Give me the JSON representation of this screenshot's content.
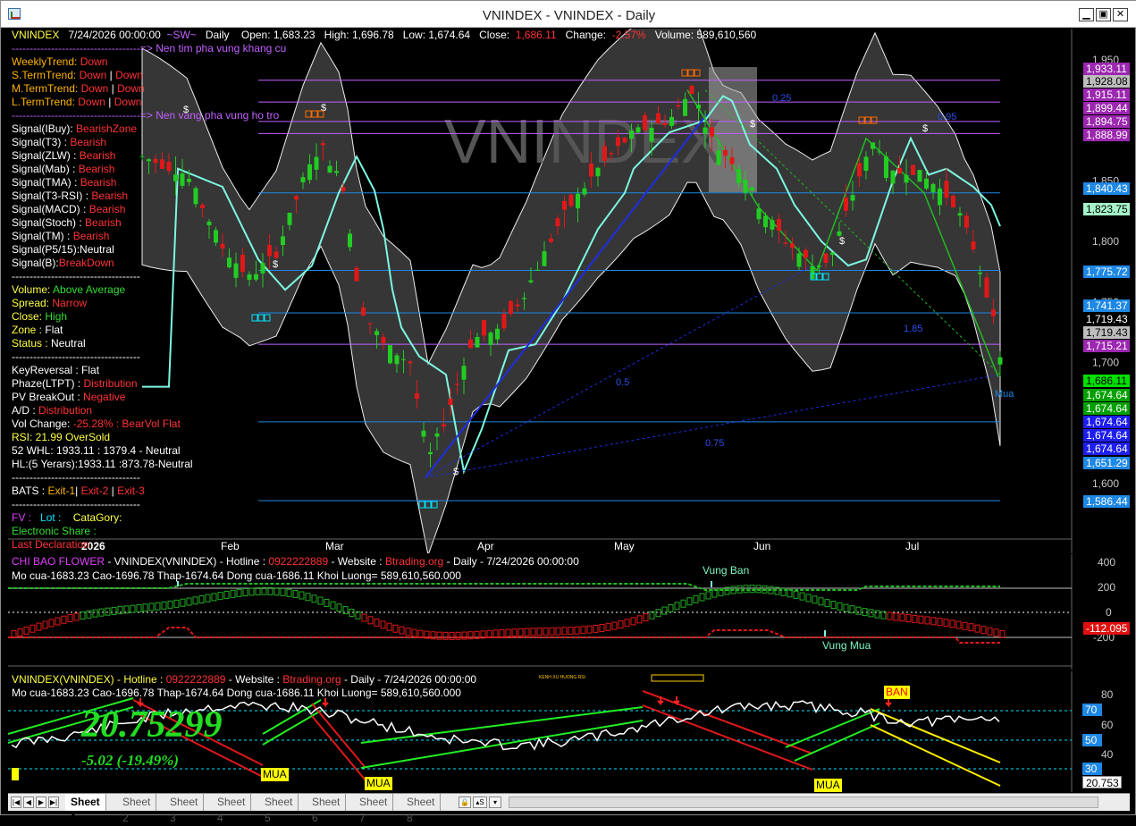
{
  "window": {
    "title": "VNINDEX - VNINDEX - Daily"
  },
  "watermark": "VNINDEX",
  "header": {
    "symbol": "VNINDEX",
    "date": "7/24/2026 00:00:00",
    "sw": "~SW~",
    "timeframe": "Daily",
    "open": "Open:  1,683.23",
    "high": "High:  1,696.78",
    "low": "Low:  1,674.64",
    "close_lbl": "Close:",
    "close_val": "1,686.11",
    "change_lbl": "Change:",
    "change_val": "-2.57%",
    "volume": "Volume:  589,610,560"
  },
  "notes": {
    "resistance": "------------------------------------=> Nen tim pha vung khang cu",
    "support": "------------------------------------=> Nen vang pha vung ho tro"
  },
  "trends": [
    {
      "label": "WeeklyTrend: ",
      "values": [
        "Down"
      ]
    },
    {
      "label": "S.TermTrend: ",
      "values": [
        "Down",
        "Down"
      ]
    },
    {
      "label": "M.TermTrend: ",
      "values": [
        "Down",
        "Down"
      ]
    },
    {
      "label": "L.TermTrend: ",
      "values": [
        "Down",
        "Down"
      ]
    }
  ],
  "signals": [
    {
      "label": "Signal(IBuy): ",
      "value": "BearishZone"
    },
    {
      "label": "Signal(T3)    :   ",
      "value": "Bearish"
    },
    {
      "label": "Signal(ZLW)  :   ",
      "value": "Bearish"
    },
    {
      "label": "Signal(Mab)  :   ",
      "value": "Bearish"
    },
    {
      "label": "Signal(TMA)  :   ",
      "value": "Bearish"
    },
    {
      "label": "Signal(T3-RSI) : ",
      "value": "Bearish"
    },
    {
      "label": "Signal(MACD) : ",
      "value": "Bearish"
    },
    {
      "label": "Signal(Stoch) : ",
      "value": "Bearish"
    },
    {
      "label": "Signal(TM) : ",
      "value": "Bearish"
    },
    {
      "label": "Signal(P5/15):",
      "value": "Neutral"
    },
    {
      "label": "Signal(B):",
      "value": "BreakDown"
    }
  ],
  "volume_block": [
    {
      "label": "Volume: ",
      "value": "Above Average",
      "color": "#33dd33"
    },
    {
      "label": "Spread:  ",
      "value": "Narrow",
      "color": "#ff3333"
    },
    {
      "label": "Close: ",
      "value": "High",
      "color": "#33dd33"
    },
    {
      "label": "Zone : ",
      "value": "Flat",
      "color": "#ffffff"
    },
    {
      "label": "Status : ",
      "value": "Neutral",
      "color": "#ffffff"
    }
  ],
  "stats": [
    {
      "label": "KeyReversal : ",
      "value": "Flat",
      "color": "#ffffff"
    },
    {
      "label": "Phaze(LTPT) : ",
      "value": "Distribution",
      "color": "#ff3333"
    },
    {
      "label": "PV BreakOut : ",
      "value": "Negative",
      "color": "#ff3333"
    },
    {
      "label": "A/D : ",
      "value": "Distribution",
      "color": "#ff3333"
    },
    {
      "label": "Vol Change: ",
      "value": "-25.28% : BearVol Flat",
      "color": "#ff3333"
    },
    {
      "label": "RSI: ",
      "value": "21.99  OverSold",
      "color": "#ffff44"
    },
    {
      "label": "52 WHL: 1933.11 : 1379.4 - Neutral",
      "value": "",
      "color": "#ffffff"
    },
    {
      "label": "HL:(5 Yerars):1933.11 :873.78-Neutral",
      "value": "",
      "color": "#ffffff"
    }
  ],
  "bats": {
    "label": "BATS : ",
    "exit1": "Exit-1",
    "exit2": "Exit-2",
    "exit3": "Exit-3"
  },
  "fv": {
    "fv": "FV :",
    "lot": "Lot :",
    "catagory": "CataGory:",
    "share": "Electronic Share :",
    "last": "Last Declaration"
  },
  "divider": "------------------------------------",
  "months": [
    "2026",
    "Feb",
    "Mar",
    "Apr",
    "May",
    "Jun",
    "Jul"
  ],
  "price_axis": [
    "1,950",
    "1,900",
    "1,850",
    "1,800",
    "1,750",
    "1,700",
    "1,650",
    "1,600"
  ],
  "price_boxes": [
    {
      "v": "1,933.11",
      "bg": "#9c27b0",
      "fg": "#ffffff"
    },
    {
      "v": "1,928.08",
      "bg": "#bdbdbd",
      "fg": "#000000"
    },
    {
      "v": "1,915.11",
      "bg": "#9c27b0",
      "fg": "#ffffff"
    },
    {
      "v": "1,899.44",
      "bg": "#9c27b0",
      "fg": "#ffffff"
    },
    {
      "v": "1,894.75",
      "bg": "#9c27b0",
      "fg": "#ffffff"
    },
    {
      "v": "1,888.99",
      "bg": "#9c27b0",
      "fg": "#ffffff"
    },
    {
      "v": "1,840.43",
      "bg": "#1e88e5",
      "fg": "#ffffff"
    },
    {
      "v": "1,823.75",
      "bg": "#a5f2c8",
      "fg": "#000000"
    },
    {
      "v": "1,775.72",
      "bg": "#1e88e5",
      "fg": "#ffffff"
    },
    {
      "v": "1,741.37",
      "bg": "#1e88e5",
      "fg": "#ffffff"
    },
    {
      "v": "1,719.43",
      "bg": "#000000",
      "fg": "#ffffff"
    },
    {
      "v": "1,719.43",
      "bg": "#bdbdbd",
      "fg": "#000000"
    },
    {
      "v": "1,715.21",
      "bg": "#9c27b0",
      "fg": "#ffffff"
    },
    {
      "v": "1,686.11",
      "bg": "#00e000",
      "fg": "#000000"
    },
    {
      "v": "1,674.64",
      "bg": "#00a000",
      "fg": "#ffffff"
    },
    {
      "v": "1,674.64",
      "bg": "#00a000",
      "fg": "#ffffff"
    },
    {
      "v": "1,674.64",
      "bg": "#1e1ef0",
      "fg": "#ffffff"
    },
    {
      "v": "1,674.64",
      "bg": "#1e1ef0",
      "fg": "#ffffff"
    },
    {
      "v": "1,674.64",
      "bg": "#1e1ef0",
      "fg": "#ffffff"
    },
    {
      "v": "1,651.29",
      "bg": "#1e88e5",
      "fg": "#ffffff"
    },
    {
      "v": "1,586.44",
      "bg": "#1e88e5",
      "fg": "#ffffff"
    }
  ],
  "fib_labels": [
    "0.25",
    "0.5",
    "0.75",
    "1.85",
    "0.95"
  ],
  "markers": {
    "dollar": "$",
    "mua": "Mua",
    "ban": "BAN",
    "mua_caps": "MUA"
  },
  "flower": {
    "title_name": "CHI BAO FLOWER",
    "title_sym": " - VNINDEX(VNINDEX) - Hotline : ",
    "hotline": "0922222889",
    "website_lbl": " - Website : ",
    "website": "Btrading.org",
    "title_tail": " - Daily  - 7/24/2026 00:00:00",
    "ohlc": "Mo cua-1683.23  Cao-1696.78  Thap-1674.64  Dong cua-1686.11  Khoi Luong= 589,610,560.000",
    "vung_ban": "Vung Ban",
    "vung_mua": "Vung Mua",
    "axis": [
      "400",
      "200",
      "0",
      "-200"
    ],
    "value": "-112.095"
  },
  "rsi": {
    "title_sym": "VNINDEX(VNINDEX) - Hotline : ",
    "hotline": "0922222889",
    "website_lbl": " - Website : ",
    "website": "Btrading.org",
    "title_tail": " - Daily  - 7/24/2026 00:00:00",
    "ohlc": "Mo cua-1683.23  Cao-1696.78  Thap-1674.64  Dong cua-1686.11  Khoi Luong= 589,610,560.000",
    "big_value": "20.75299",
    "change": "-5.02 (-19.49%)",
    "channel_title": "KENH XU HUONG RSI",
    "axis": [
      "80",
      "60",
      "40",
      "20"
    ],
    "levels": [
      "70",
      "50",
      "30"
    ],
    "value": "20.753"
  },
  "tabs": {
    "items": [
      "Sheet 1",
      "Sheet 2",
      "Sheet 3",
      "Sheet 4",
      "Sheet 5",
      "Sheet 6",
      "Sheet 7",
      "Sheet 8"
    ],
    "active": 0
  }
}
